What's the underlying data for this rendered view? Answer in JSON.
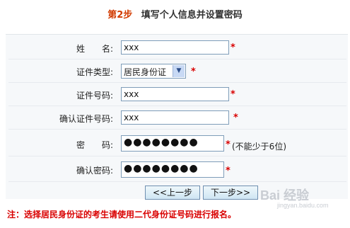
{
  "header": {
    "step_num": "第2步",
    "step_title": "填写个人信息并设置密码"
  },
  "form": {
    "name_label": "姓　　名:",
    "name_value": "xxx",
    "id_type_label": "证件类型:",
    "id_type_value": "居民身份证",
    "id_number_label": "证件号码:",
    "id_number_value": "xxx",
    "confirm_id_label": "确认证件号码:",
    "confirm_id_value": "xxx",
    "password_label": "密　　码:",
    "password_value": "●●●●●●●●",
    "password_hint": "(不能少于6位)",
    "confirm_password_label": "确认密码:",
    "confirm_password_value": "●●●●●●●●",
    "required_mark": "*"
  },
  "buttons": {
    "prev": "<<上一步",
    "next": "下一步>>"
  },
  "note": "注：选择居民身份证的考生请使用二代身份证号码进行报名。",
  "watermark": {
    "main": "Bai 经验",
    "sub": "jingyan.baidu.com"
  }
}
